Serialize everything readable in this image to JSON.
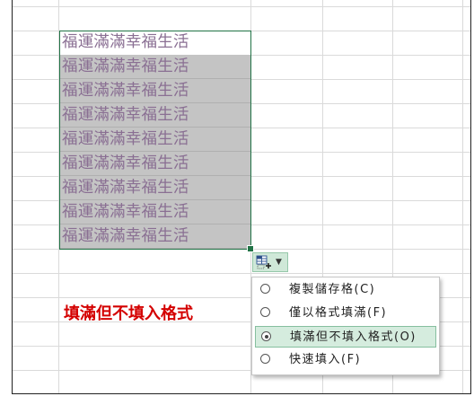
{
  "sheet": {
    "cells": [
      "福運滿滿幸福生活",
      "福運滿滿幸福生活",
      "福運滿滿幸福生活",
      "福運滿滿幸福生活",
      "福運滿滿幸福生活",
      "福運滿滿幸福生活",
      "福運滿滿幸福生活",
      "福運滿滿幸福生活",
      "福運滿滿幸福生活"
    ],
    "text_color": "#8a6f93",
    "fill_color": "#c4c4c4",
    "selection_color": "#217346"
  },
  "autofill_button": {
    "icon": "auto-fill-options-icon",
    "caret": "▼"
  },
  "annotation": {
    "text": "填滿但不填入格式",
    "color": "#d40000"
  },
  "menu": {
    "items": [
      {
        "label": "複製儲存格(C)",
        "checked": false
      },
      {
        "label": "僅以格式填滿(F)",
        "checked": false
      },
      {
        "label": "填滿但不填入格式(O)",
        "checked": true
      },
      {
        "label": "快速填入(F)",
        "checked": false
      }
    ]
  }
}
